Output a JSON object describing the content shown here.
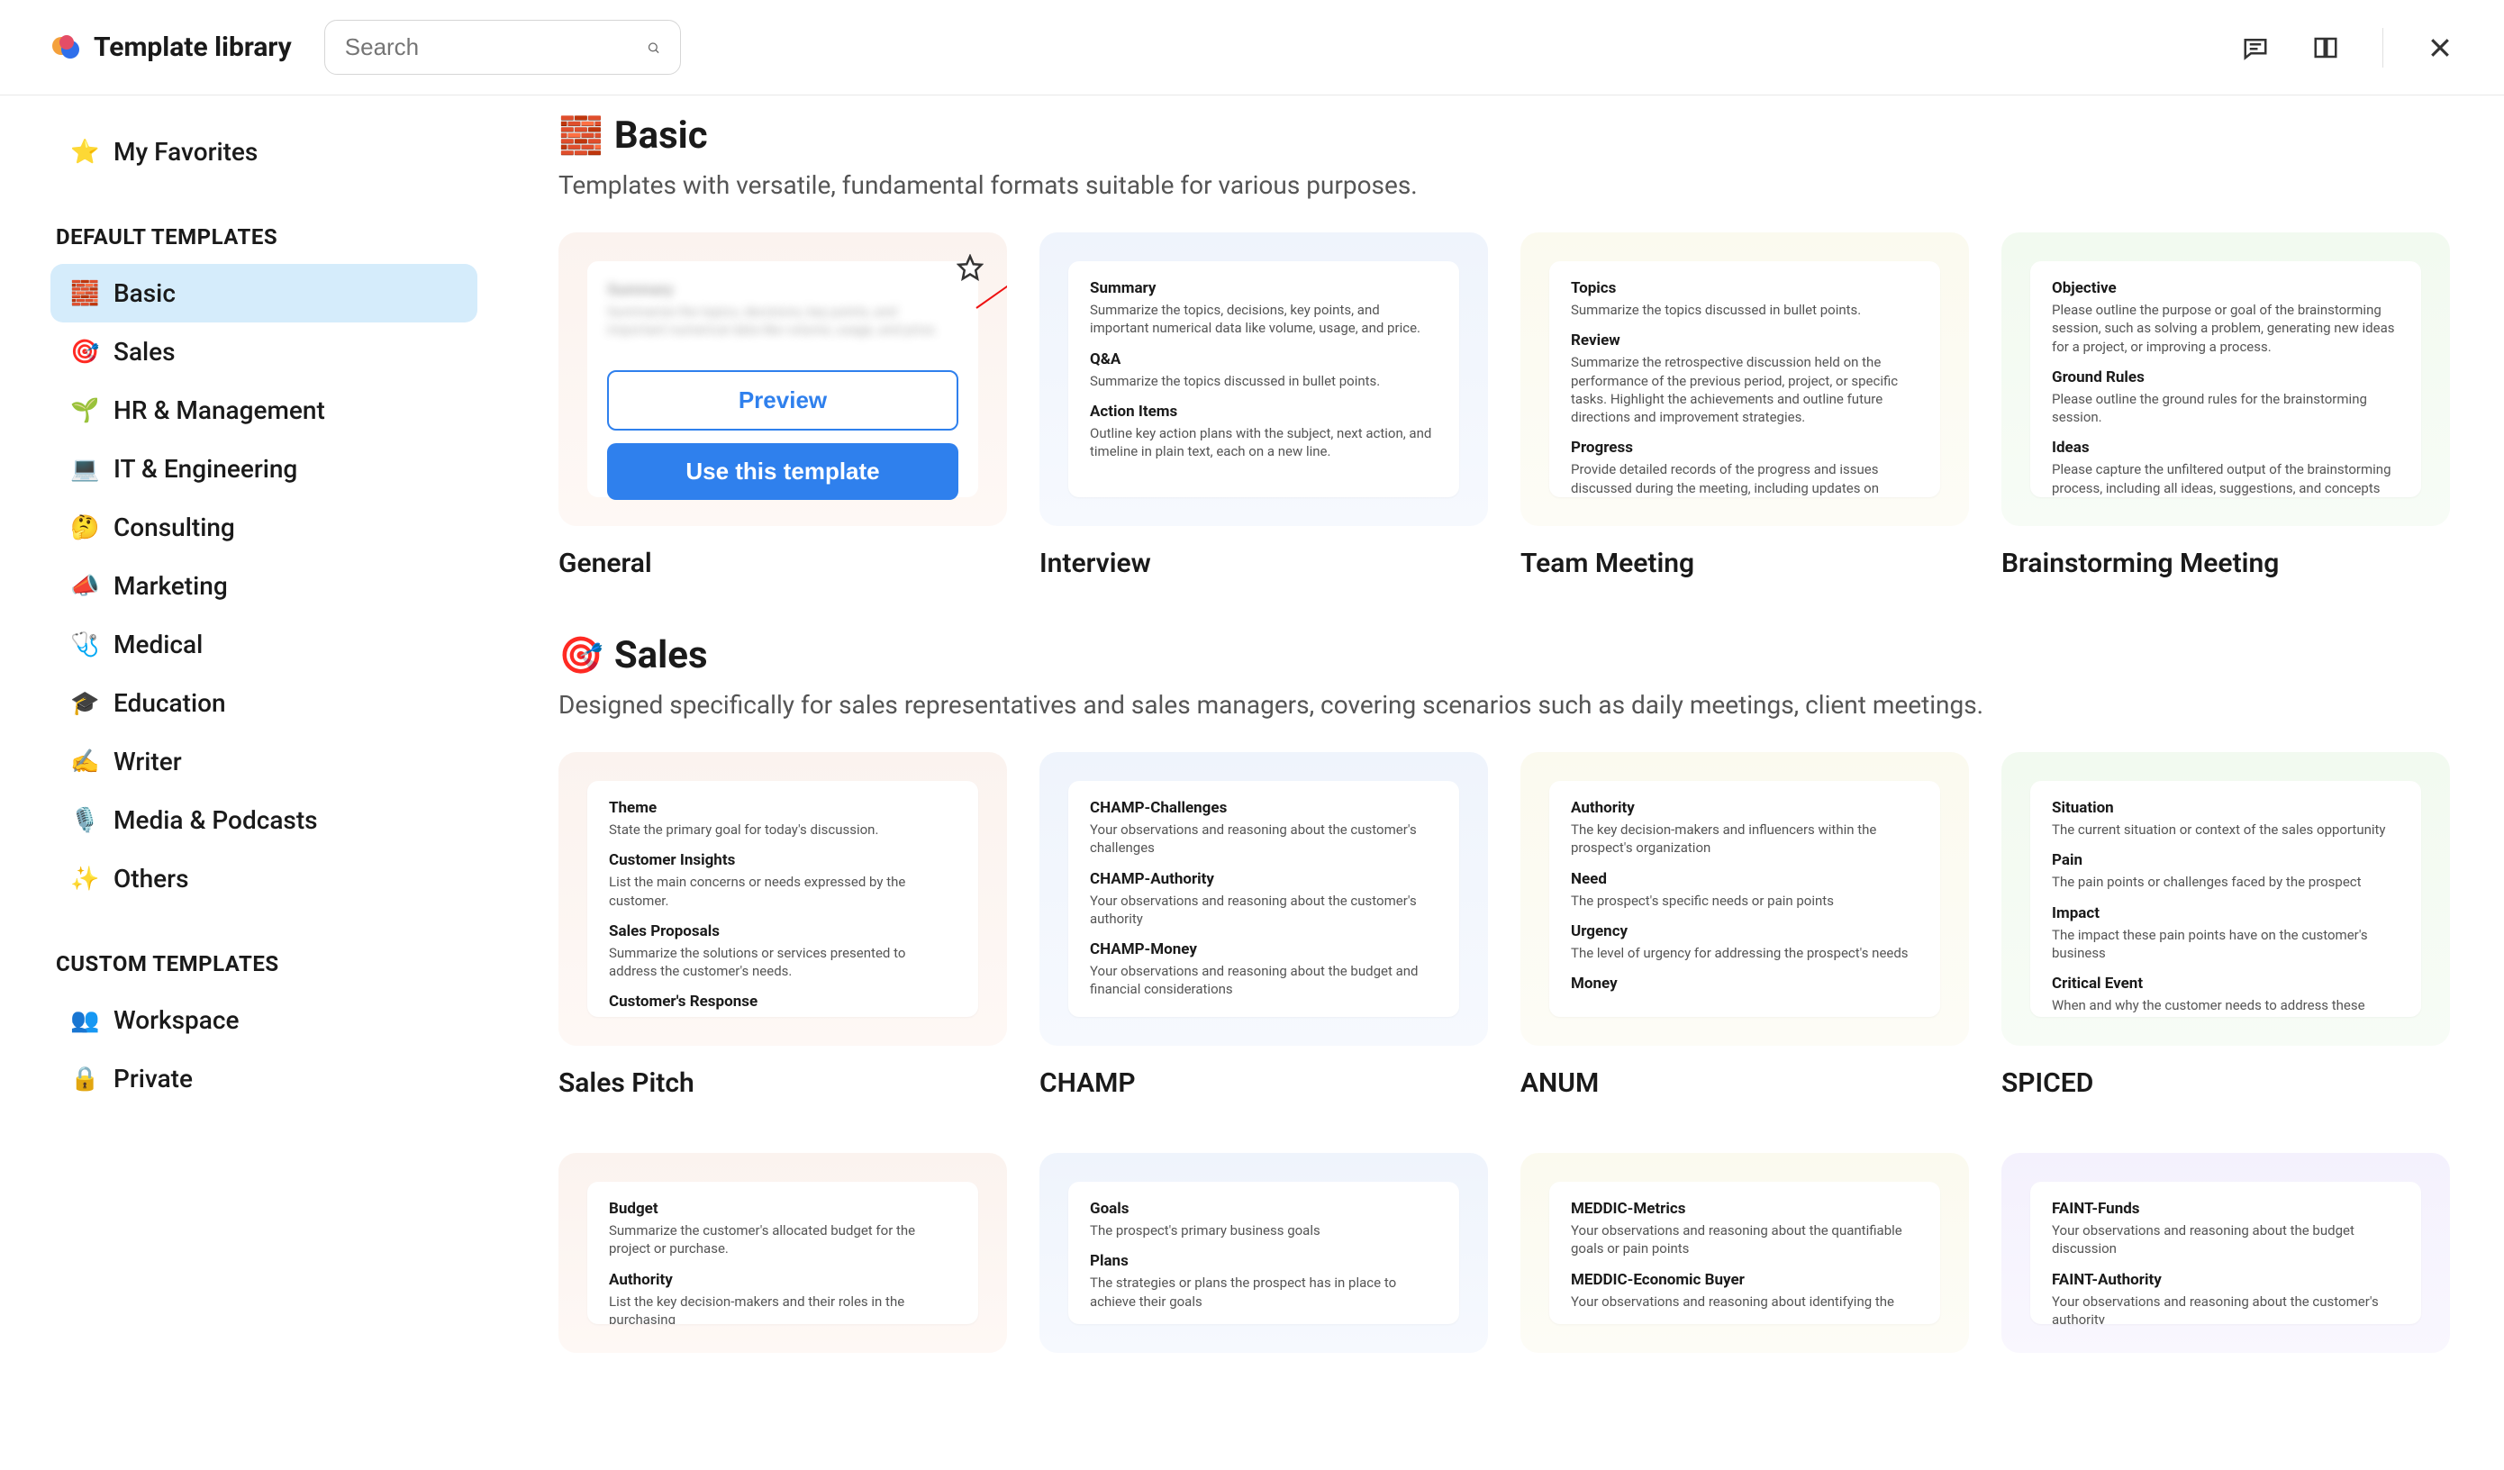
{
  "header": {
    "title": "Template library",
    "search_placeholder": "Search"
  },
  "tooltip": "Add to favorites",
  "hover_card": {
    "preview": "Preview",
    "use": "Use this template"
  },
  "sidebar": {
    "favorites": {
      "emoji": "⭐",
      "label": "My Favorites"
    },
    "heading_default": "DEFAULT TEMPLATES",
    "default_items": [
      {
        "emoji": "🧱",
        "label": "Basic",
        "active": true
      },
      {
        "emoji": "🎯",
        "label": "Sales"
      },
      {
        "emoji": "🌱",
        "label": "HR & Management"
      },
      {
        "emoji": "💻",
        "label": "IT & Engineering"
      },
      {
        "emoji": "🤔",
        "label": "Consulting"
      },
      {
        "emoji": "📣",
        "label": "Marketing"
      },
      {
        "emoji": "🩺",
        "label": "Medical"
      },
      {
        "emoji": "🎓",
        "label": "Education"
      },
      {
        "emoji": "✍️",
        "label": "Writer"
      },
      {
        "emoji": "🎙️",
        "label": "Media & Podcasts"
      },
      {
        "emoji": "✨",
        "label": "Others"
      }
    ],
    "heading_custom": "CUSTOM TEMPLATES",
    "custom_items": [
      {
        "emoji": "👥",
        "label": "Workspace"
      },
      {
        "emoji": "🔒",
        "label": "Private"
      }
    ]
  },
  "sections": [
    {
      "emoji": "🧱",
      "title": "Basic",
      "desc": "Templates with versatile, fundamental formats suitable for various purposes.",
      "cards": [
        {
          "name": "General",
          "bg": "bg-pink",
          "hover": true,
          "blocks": [
            {
              "h": "Summary",
              "p": "Summarize the topics, decisions, key points, and important numerical data like volume, usage, and price."
            }
          ]
        },
        {
          "name": "Interview",
          "bg": "bg-blue",
          "blocks": [
            {
              "h": "Summary",
              "p": "Summarize the topics, decisions, key points, and important numerical data like volume, usage, and price."
            },
            {
              "h": "Q&A",
              "p": "Summarize the topics discussed in bullet points."
            },
            {
              "h": "Action Items",
              "p": "Outline key action plans with the subject, next action, and timeline in plain text, each on a new line."
            }
          ]
        },
        {
          "name": "Team Meeting",
          "bg": "bg-yellow",
          "blocks": [
            {
              "h": "Topics",
              "p": "Summarize the topics discussed in bullet points."
            },
            {
              "h": "Review",
              "p": "Summarize the retrospective discussion held on the performance of the previous period, project, or specific tasks. Highlight the achievements and outline future directions and improvement strategies."
            },
            {
              "h": "Progress",
              "p": "Provide detailed records of the progress and issues discussed during the meeting, including updates on projects and tasks."
            }
          ]
        },
        {
          "name": "Brainstorming Meeting",
          "bg": "bg-green",
          "blocks": [
            {
              "h": "Objective",
              "p": "Please outline the purpose or goal of the brainstorming session, such as solving a problem, generating new ideas for a project, or improving a process."
            },
            {
              "h": "Ground Rules",
              "p": "Please outline the ground rules for the brainstorming session."
            },
            {
              "h": "Ideas",
              "p": "Please capture the unfiltered output of the brainstorming process, including all ideas, suggestions, and concepts proposed by participants, without any judgment or evaluation."
            }
          ]
        }
      ]
    },
    {
      "emoji": "🎯",
      "title": "Sales",
      "desc": "Designed specifically for sales representatives and sales managers, covering scenarios such as daily meetings, client meetings.",
      "cards": [
        {
          "name": "Sales Pitch",
          "bg": "bg-pink",
          "blocks": [
            {
              "h": "Theme",
              "p": "State the primary goal for today's discussion."
            },
            {
              "h": "Customer Insights",
              "p": "List the main concerns or needs expressed by the customer."
            },
            {
              "h": "Sales Proposals",
              "p": "Summarize the solutions or services presented to address the customer's needs."
            },
            {
              "h": "Customer's Response",
              "p": ""
            }
          ]
        },
        {
          "name": "CHAMP",
          "bg": "bg-blue",
          "blocks": [
            {
              "h": "CHAMP-Challenges",
              "p": "Your observations and reasoning about the customer's challenges"
            },
            {
              "h": "CHAMP-Authority",
              "p": "Your observations and reasoning about the customer's authority"
            },
            {
              "h": "CHAMP-Money",
              "p": "Your observations and reasoning about the budget and financial considerations"
            }
          ]
        },
        {
          "name": "ANUM",
          "bg": "bg-yellow",
          "blocks": [
            {
              "h": "Authority",
              "p": "The key decision-makers and influencers within the prospect's organization"
            },
            {
              "h": "Need",
              "p": "The prospect's specific needs or pain points"
            },
            {
              "h": "Urgency",
              "p": "The level of urgency for addressing the prospect's needs"
            },
            {
              "h": "Money",
              "p": ""
            }
          ]
        },
        {
          "name": "SPICED",
          "bg": "bg-green",
          "blocks": [
            {
              "h": "Situation",
              "p": "The current situation or context of the sales opportunity"
            },
            {
              "h": "Pain",
              "p": "The pain points or challenges faced by the prospect"
            },
            {
              "h": "Impact",
              "p": "The impact these pain points have on the customer's business"
            },
            {
              "h": "Critical Event",
              "p": "When and why the customer needs to address these issues"
            }
          ]
        }
      ]
    },
    {
      "emoji": "",
      "title": "",
      "desc": "",
      "partial": true,
      "cards": [
        {
          "name": "",
          "bg": "bg-pink",
          "blocks": [
            {
              "h": "Budget",
              "p": "Summarize the customer's allocated budget for the project or purchase."
            },
            {
              "h": "Authority",
              "p": "List the key decision-makers and their roles in the purchasing"
            }
          ]
        },
        {
          "name": "",
          "bg": "bg-blue",
          "blocks": [
            {
              "h": "Goals",
              "p": "The prospect's primary business goals"
            },
            {
              "h": "Plans",
              "p": "The strategies or plans the prospect has in place to achieve their goals"
            }
          ]
        },
        {
          "name": "",
          "bg": "bg-yellow",
          "blocks": [
            {
              "h": "MEDDIC-Metrics",
              "p": "Your observations and reasoning about the quantifiable goals or pain points"
            },
            {
              "h": "MEDDIC-Economic Buyer",
              "p": "Your observations and reasoning about identifying the"
            }
          ]
        },
        {
          "name": "",
          "bg": "bg-lav",
          "blocks": [
            {
              "h": "FAINT-Funds",
              "p": "Your observations and reasoning about the budget discussion"
            },
            {
              "h": "FAINT-Authority",
              "p": "Your observations and reasoning about the customer's authority"
            }
          ]
        }
      ]
    }
  ]
}
